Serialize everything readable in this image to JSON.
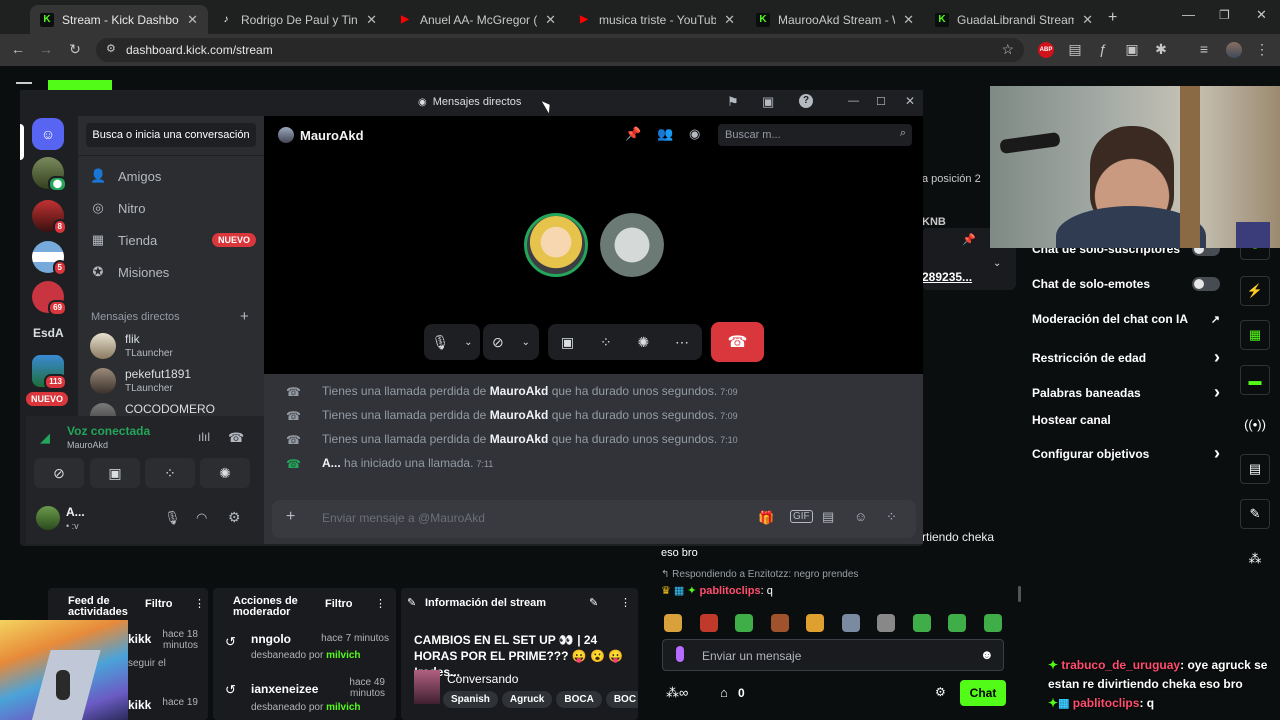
{
  "browser": {
    "tabs": [
      {
        "title": "Stream - Kick Dashboard",
        "favicon": "kick-icon",
        "color": "#53fc18",
        "active": true
      },
      {
        "title": "Rodrigo De Paul y Tini: Un Re",
        "favicon": "tiktok-icon",
        "color": "#ffffff",
        "active": false
      },
      {
        "title": "Anuel AA- McGregor (Audio",
        "favicon": "youtube-icon",
        "color": "#ff0000",
        "active": false
      },
      {
        "title": "musica triste - YouTube",
        "favicon": "youtube-icon",
        "color": "#ff0000",
        "active": false
      },
      {
        "title": "MaurooAkd Stream - Watch",
        "favicon": "kick-icon",
        "color": "#53fc18",
        "active": false
      },
      {
        "title": "GuadaLibrandi Stream - Wat",
        "favicon": "kick-icon",
        "color": "#53fc18",
        "active": false
      }
    ],
    "url": "dashboard.kick.com/stream"
  },
  "discord": {
    "window_title": "Mensajes directos",
    "search_placeholder": "Busca o inicia una conversación",
    "nav": [
      {
        "label": "Amigos",
        "icon": "friends-icon"
      },
      {
        "label": "Nitro",
        "icon": "nitro-icon"
      },
      {
        "label": "Tienda",
        "icon": "shop-icon",
        "badge": "NUEVO"
      },
      {
        "label": "Misiones",
        "icon": "quests-icon"
      }
    ],
    "dm_header": "Mensajes directos",
    "dms": [
      {
        "name": "flik",
        "status": "TLauncher"
      },
      {
        "name": "pekefut1891",
        "status": "TLauncher"
      },
      {
        "name": "COCODOMERO",
        "status": ""
      }
    ],
    "guild_badges": [
      "8",
      "5",
      "69",
      "113"
    ],
    "guild_label": "EsdA",
    "guild_new": "NUEVO",
    "voice": {
      "status": "Voz conectada",
      "channel": "MauroAkd"
    },
    "user": {
      "name": "A...",
      "status": "• :v"
    },
    "call_user": "MauroAkd",
    "call_search": "Buscar m...",
    "messages": [
      {
        "pre": "Tienes una llamada perdida de",
        "user": "MauroAkd",
        "post": "que ha durado unos segundos.",
        "time": "7:09",
        "icon": "missed"
      },
      {
        "pre": "Tienes una llamada perdida de",
        "user": "MauroAkd",
        "post": "que ha durado unos segundos.",
        "time": "7:09",
        "icon": "missed"
      },
      {
        "pre": "Tienes una llamada perdida de",
        "user": "MauroAkd",
        "post": "que ha durado unos segundos.",
        "time": "7:10",
        "icon": "missed"
      },
      {
        "pre": "",
        "user": "A...",
        "post": "ha iniciado una llamada.",
        "time": "7:11",
        "icon": "started"
      }
    ],
    "input_placeholder": "Enviar mensaje a @MauroAkd"
  },
  "kick": {
    "settings": [
      {
        "label": "Chat de solo-suscriptores",
        "type": "toggle"
      },
      {
        "label": "Chat de solo-emotes",
        "type": "toggle"
      },
      {
        "label": "Moderación del chat con IA",
        "type": "external"
      },
      {
        "label": "Restricción de edad",
        "type": "arrow"
      },
      {
        "label": "Palabras baneadas",
        "type": "arrow"
      },
      {
        "label": "Hostear canal",
        "type": "none"
      },
      {
        "label": "Configurar objetivos",
        "type": "arrow"
      }
    ],
    "partial_texts": {
      "position": "a posición 2",
      "code": "KNB",
      "number": "289235...",
      "rtext": "rtiendo cheka"
    },
    "activity": {
      "title": "Feed de actividades",
      "filter": "Filtro",
      "items": [
        {
          "user": "kikk",
          "time": "hace 18 minutos",
          "action": "seguir el"
        },
        {
          "user": "kikk",
          "time": "hace 19",
          "action": ""
        }
      ]
    },
    "mod": {
      "title": "Acciones de moderador",
      "filter": "Filtro",
      "items": [
        {
          "user": "nngolo",
          "time": "hace 7 minutos",
          "action": "desbaneado por",
          "by": "milvich"
        },
        {
          "user": "ianxeneizee",
          "time": "hace 49 minutos",
          "action": "desbaneado por",
          "by": "milvich"
        }
      ]
    },
    "info": {
      "title": "Información del stream",
      "stream_title": "CAMBIOS EN EL SET UP 👀 | 24 HORAS POR EL PRIME??? 😛 😮 😛 !redes...",
      "category": "Conversando",
      "tags": [
        "Spanish",
        "Agruck",
        "BOCA",
        "BOC"
      ]
    },
    "chat": {
      "line1": "eso bro",
      "reply": "Respondiendo a Enzitotzz: negro prendes",
      "user": "pablitoclips",
      "msg": ": q",
      "input_placeholder": "Enviar un mensaje",
      "points": "0",
      "send": "Chat"
    },
    "overlay_chat": [
      {
        "user": "trabuco_de_uruguay",
        "msg": ": oye agruck se estan re divirtiendo cheka eso bro",
        "color": "#ff4d6d"
      },
      {
        "user": "pablitoclips",
        "msg": ": q",
        "color": "#ff4d6d"
      }
    ]
  }
}
